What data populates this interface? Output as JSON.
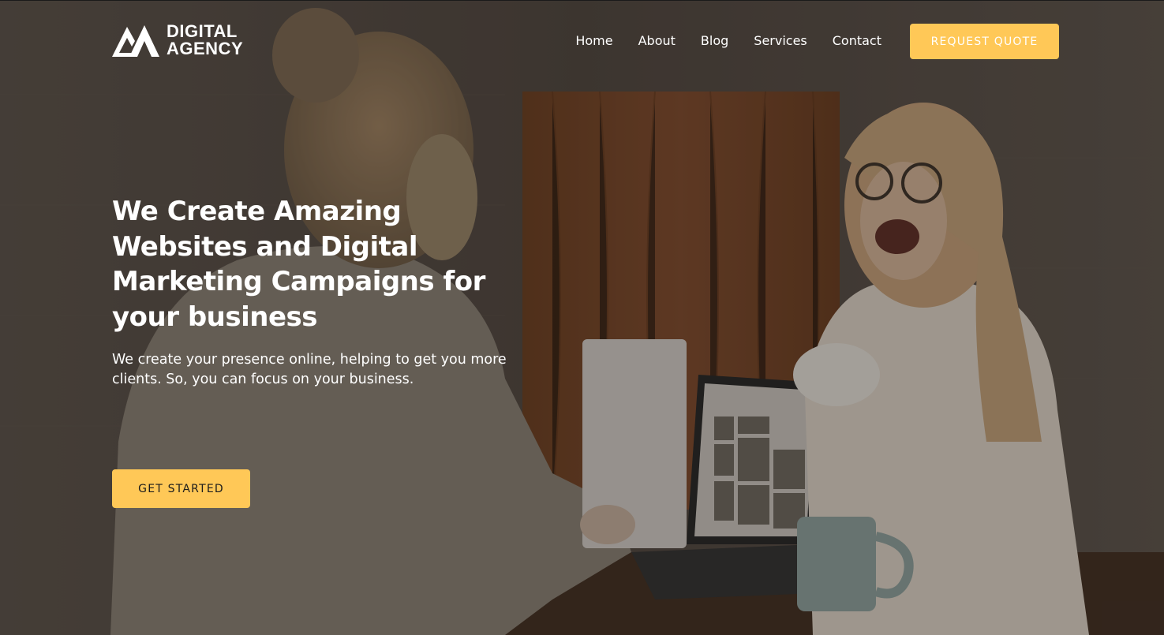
{
  "brand": {
    "logo_icon": "mountain-logo-icon",
    "line1": "DIGITAL",
    "line2": "AGENCY"
  },
  "nav": {
    "items": [
      {
        "label": "Home"
      },
      {
        "label": "About"
      },
      {
        "label": "Blog"
      },
      {
        "label": "Services"
      },
      {
        "label": "Contact"
      }
    ],
    "quote_button": "REQUEST QUOTE"
  },
  "hero": {
    "headline": "We Create Amazing Websites and Digital Marketing Campaigns for your business",
    "subtext": "We create your presence online, helping to get you more clients. So, you can focus on your business.",
    "cta": "GET STARTED"
  },
  "colors": {
    "accent": "#ffc857",
    "text": "#ffffff",
    "cta_text": "#1c1c1c"
  }
}
